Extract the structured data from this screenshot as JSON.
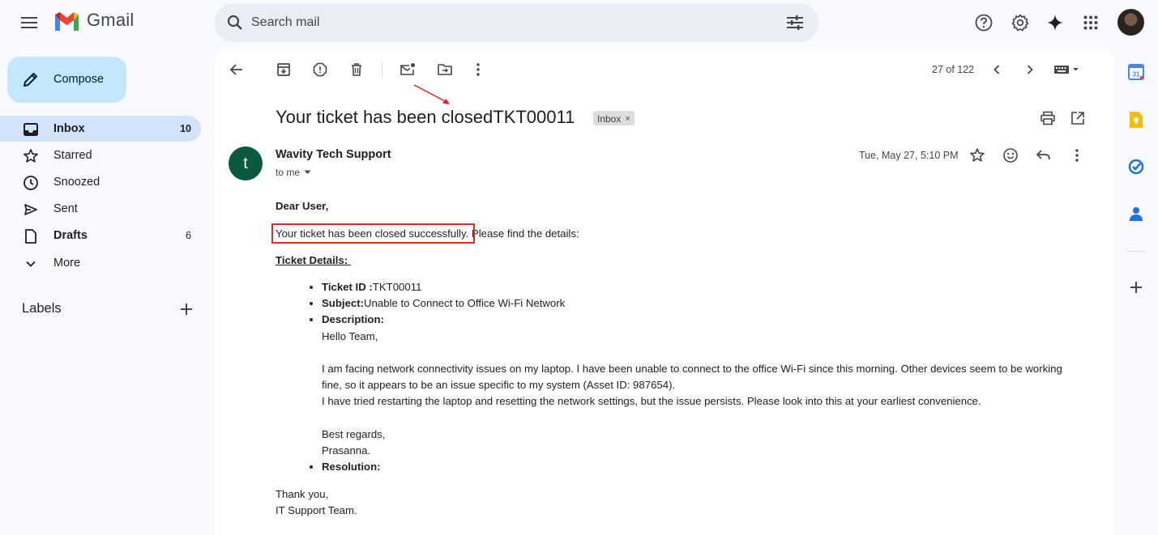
{
  "app": {
    "name": "Gmail"
  },
  "search": {
    "placeholder": "Search mail"
  },
  "compose": {
    "label": "Compose"
  },
  "nav": [
    {
      "label": "Inbox",
      "count": "10",
      "icon": "inbox-icon"
    },
    {
      "label": "Starred",
      "count": "",
      "icon": "star-icon"
    },
    {
      "label": "Snoozed",
      "count": "",
      "icon": "clock-icon"
    },
    {
      "label": "Sent",
      "count": "",
      "icon": "send-icon"
    },
    {
      "label": "Drafts",
      "count": "6",
      "icon": "draft-icon"
    },
    {
      "label": "More",
      "count": "",
      "icon": "chevron-down-icon"
    }
  ],
  "labels": {
    "title": "Labels"
  },
  "pager": {
    "text": "27 of 122"
  },
  "email": {
    "subject": "Your ticket has been closedTKT00011",
    "chip": "Inbox",
    "sender_initial": "t",
    "sender_name": "Wavity Tech Support",
    "to": "to me",
    "date": "Tue, May 27, 5:10 PM",
    "greeting": "Dear User,",
    "closed_text": "Your ticket has been closed successfully.",
    "find_text": " Please find the details:",
    "details_heading": "Ticket Details: ",
    "ticket_id_label": "Ticket ID :",
    "ticket_id": "TKT00011",
    "subject_label": "Subject:",
    "subject_value": "Unable to Connect to Office Wi-Fi Network",
    "description_label": "Description:",
    "desc_line1": "Hello Team,",
    "desc_line2": "I am facing network connectivity issues on my laptop. I have been unable to connect to the office Wi-Fi since this morning. Other devices seem to be working fine, so it appears to be an issue specific to my system (Asset ID: 987654).",
    "desc_line3": "I have tried restarting the laptop and resetting the network settings, but the issue persists. Please look into this at your earliest convenience.",
    "desc_line4": "Best regards,",
    "desc_line5": "Prasanna.",
    "resolution_label": "Resolution:",
    "closing1": "Thank you,",
    "closing2": "IT Support Team."
  },
  "colors": {
    "compose_bg": "#c2e7ff",
    "active_nav": "#d3e3fd",
    "highlight": "#d93025",
    "avatar_bg": "#0b5940"
  }
}
